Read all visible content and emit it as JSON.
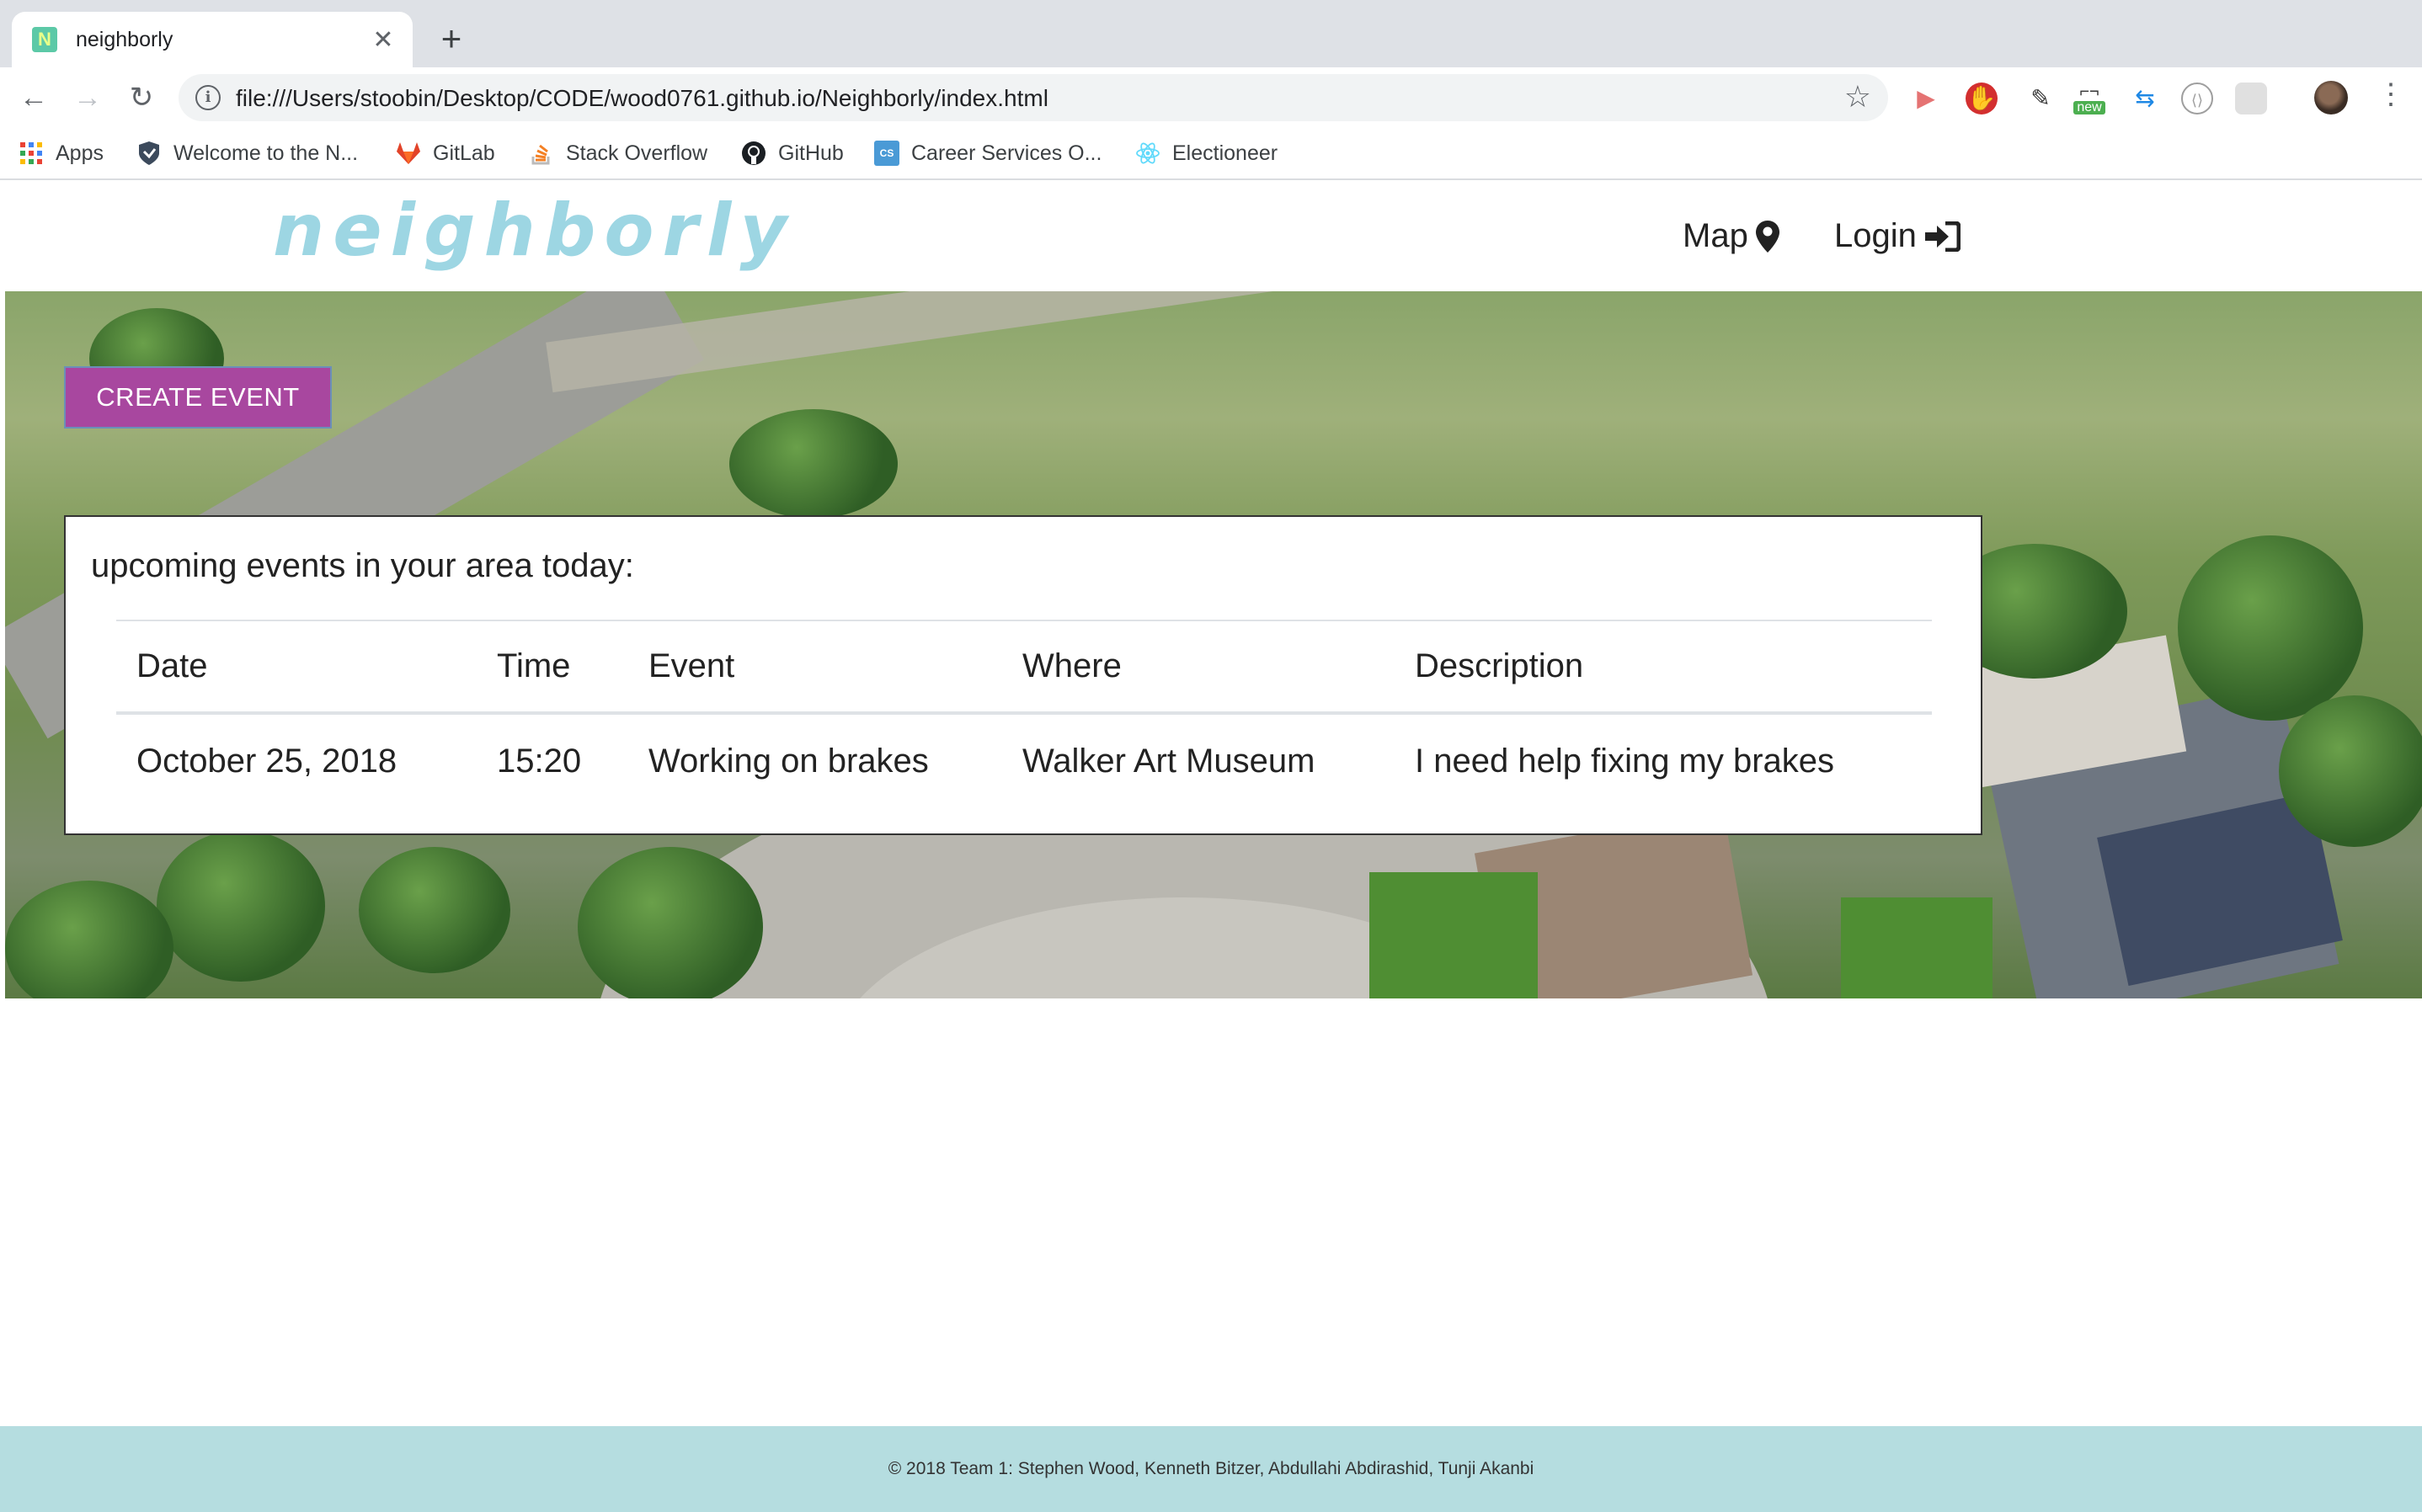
{
  "browser": {
    "tab_title": "neighborly",
    "favicon_letter": "N",
    "url": "file:///Users/stoobin/Desktop/CODE/wood0761.github.io/Neighborly/index.html",
    "extension_badge": "new",
    "bookmarks": [
      {
        "label": "Apps",
        "icon": "apps-grid-icon"
      },
      {
        "label": "Welcome to the N...",
        "icon": "shield-icon"
      },
      {
        "label": "GitLab",
        "icon": "gitlab-icon"
      },
      {
        "label": "Stack Overflow",
        "icon": "stackoverflow-icon"
      },
      {
        "label": "GitHub",
        "icon": "github-icon"
      },
      {
        "label": "Career Services O...",
        "icon": "cs-icon",
        "icon_text": "CS"
      },
      {
        "label": "Electioneer",
        "icon": "react-icon"
      }
    ]
  },
  "site": {
    "logo": "neighborly",
    "nav": {
      "map": "Map",
      "login": "Login"
    },
    "create_event": "CREATE EVENT",
    "events": {
      "heading": "upcoming events in your area today:",
      "columns": [
        "Date",
        "Time",
        "Event",
        "Where",
        "Description"
      ],
      "rows": [
        [
          "October 25, 2018",
          "15:20",
          "Working on brakes",
          "Walker Art Museum",
          "I need help fixing my brakes"
        ]
      ]
    },
    "footer": "© 2018 Team 1: Stephen Wood, Kenneth Bitzer, Abdullahi Abdirashid, Tunji Akanbi"
  },
  "colors": {
    "logo": "#9dd6e3",
    "create_button": "#a8479f",
    "footer_bg": "#b5dde0"
  }
}
